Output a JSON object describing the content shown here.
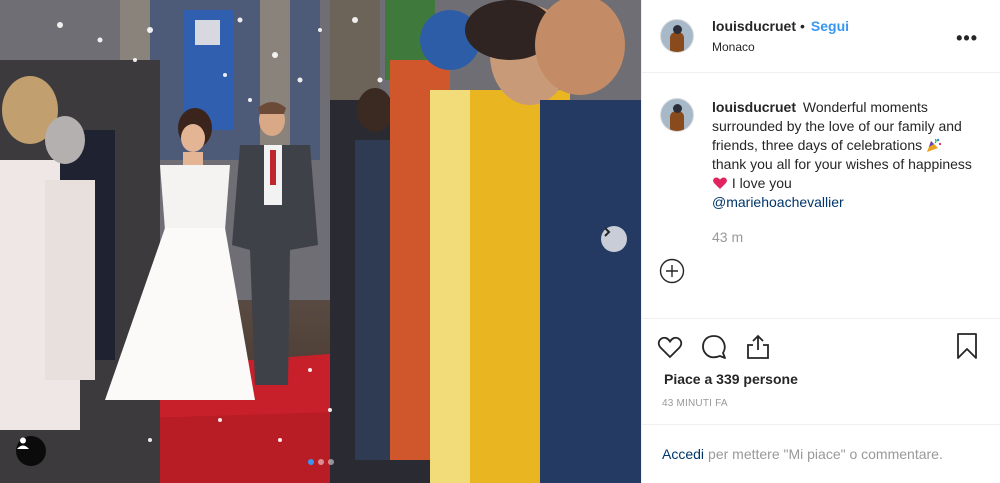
{
  "post": {
    "username": "louisducruet",
    "separator": "•",
    "follow_label": "Segui",
    "location": "Monaco",
    "more_label": "•••"
  },
  "caption": {
    "username": "louisducruet",
    "text_part1": "Wonderful moments surrounded by the love of our family and friends, three days of celebrations",
    "emoji_party": "party-popper-icon",
    "text_part2": "thank you all for your wishes of happiness",
    "emoji_heart": "red-heart-icon",
    "text_part3": "I love you",
    "mention": "@mariehoachevallier",
    "time": "43 m"
  },
  "actions": {
    "icons": [
      "heart-icon",
      "comment-icon",
      "share-icon",
      "bookmark-icon"
    ]
  },
  "likes_text": "Piace a 339 persone",
  "posted_ago": "43 MINUTI FA",
  "footer": {
    "login_label": "Accedi",
    "rest": "per mettere \"Mi piace\" o commentare."
  },
  "carousel": {
    "slides": 3,
    "active_index": 0
  },
  "colors": {
    "link_blue": "#3897f0",
    "mention_blue": "#003569",
    "muted": "#999999",
    "heart_red": "#e0245e",
    "carpet_red": "#c8202a"
  }
}
